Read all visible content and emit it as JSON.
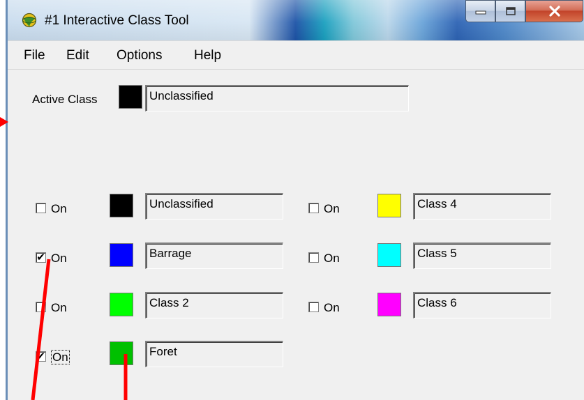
{
  "window": {
    "title": "#1 Interactive Class Tool",
    "icon": "globe-icon",
    "controls": [
      "minimize-icon",
      "maximize-icon",
      "close-icon"
    ]
  },
  "menu": [
    "File",
    "Edit",
    "Options",
    "Help"
  ],
  "active_class": {
    "label": "Active Class",
    "color": "#000000",
    "name": "Unclassified"
  },
  "toggle_label": "On",
  "classes": [
    {
      "name": "Unclassified",
      "color": "#000000",
      "checked": false
    },
    {
      "name": "Barrage",
      "color": "#0000ff",
      "checked": true
    },
    {
      "name": "Class 2",
      "color": "#00ff00",
      "checked": false
    },
    {
      "name": "Foret",
      "color": "#00c000",
      "checked": true
    },
    {
      "name": "Class 4",
      "color": "#ffff00",
      "checked": false
    },
    {
      "name": "Class 5",
      "color": "#00ffff",
      "checked": false
    },
    {
      "name": "Class 6",
      "color": "#ff00ff",
      "checked": false
    }
  ],
  "check_mark": "✔",
  "annotation_color": "#ff0000"
}
